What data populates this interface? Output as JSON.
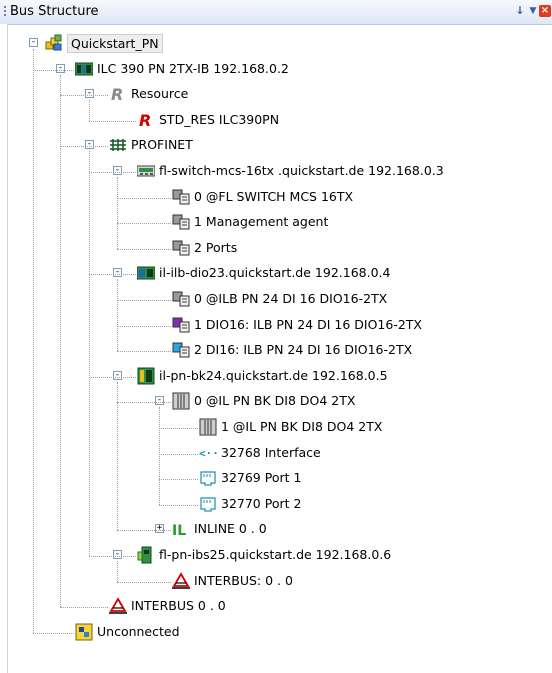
{
  "panel": {
    "title": "Bus Structure",
    "pin_glyph": "↓",
    "menu_glyph": "▼",
    "close_glyph": "×"
  },
  "tree": [
    {
      "label": "Quickstart_PN",
      "icon": "project-icon",
      "level": 0,
      "expander": "minus",
      "selected": true
    },
    {
      "label": "ILC 390 PN 2TX-IB 192.168.0.2",
      "icon": "controller-icon",
      "level": 1,
      "expander": "minus"
    },
    {
      "label": "Resource",
      "icon": "resource-gray-icon",
      "icon_text": "R",
      "level": 2,
      "expander": "minus"
    },
    {
      "label": "STD_RES ILC390PN",
      "icon": "resource-red-icon",
      "icon_text": "R",
      "level": 3,
      "expander": "none"
    },
    {
      "label": "PROFINET",
      "icon": "profinet-icon",
      "level": 2,
      "expander": "minus"
    },
    {
      "label": "fl-switch-mcs-16tx .quickstart.de 192.168.0.3",
      "icon": "switch-icon",
      "level": 3,
      "expander": "minus"
    },
    {
      "label": "0 @FL SWITCH MCS 16TX",
      "icon": "submodule-icon",
      "level": 4,
      "expander": "none"
    },
    {
      "label": "1 Management agent",
      "icon": "submodule-icon",
      "level": 4,
      "expander": "none"
    },
    {
      "label": "2 Ports",
      "icon": "submodule-icon",
      "level": 4,
      "expander": "none"
    },
    {
      "label": "il-ilb-dio23.quickstart.de 192.168.0.4",
      "icon": "ilb-device-icon",
      "level": 3,
      "expander": "minus"
    },
    {
      "label": "0 @ILB PN 24 DI 16 DIO16-2TX",
      "icon": "submodule-icon",
      "level": 4,
      "expander": "none"
    },
    {
      "label": "1 DIO16: ILB PN 24 DI 16 DIO16-2TX",
      "icon": "submodule-purple-icon",
      "level": 4,
      "expander": "none"
    },
    {
      "label": "2 DI16: ILB PN 24 DI 16 DIO16-2TX",
      "icon": "submodule-blue-icon",
      "level": 4,
      "expander": "none"
    },
    {
      "label": "il-pn-bk24.quickstart.de 192.168.0.5",
      "icon": "bus-coupler-icon",
      "level": 3,
      "expander": "minus"
    },
    {
      "label": "0 @IL PN BK DI8 DO4 2TX",
      "icon": "module-icon",
      "level": 4,
      "expander": "minus"
    },
    {
      "label": "1 @IL PN BK DI8 DO4 2TX",
      "icon": "module-icon",
      "level": 5,
      "expander": "none"
    },
    {
      "label": "32768 Interface",
      "icon": "interface-icon",
      "icon_text": "<··>",
      "level": 5,
      "expander": "none"
    },
    {
      "label": "32769 Port 1",
      "icon": "port-icon",
      "level": 5,
      "expander": "none"
    },
    {
      "label": "32770 Port 2",
      "icon": "port-icon",
      "level": 5,
      "expander": "none"
    },
    {
      "label": "INLINE 0 . 0",
      "icon": "inline-icon",
      "icon_text": "IL",
      "level": 4,
      "expander": "plus"
    },
    {
      "label": "fl-pn-ibs25.quickstart.de 192.168.0.6",
      "icon": "ibs-proxy-icon",
      "level": 3,
      "expander": "minus"
    },
    {
      "label": "INTERBUS: 0 . 0",
      "icon": "interbus-icon",
      "level": 4,
      "expander": "none"
    },
    {
      "label": "INTERBUS 0 . 0",
      "icon": "interbus-icon",
      "level": 2,
      "expander": "none"
    },
    {
      "label": "Unconnected",
      "icon": "unconnected-icon",
      "level": 1,
      "expander": "none"
    }
  ],
  "colors": {
    "title_gradient_top": "#f6f8fc",
    "title_gradient_bottom": "#dfe7f5",
    "tree_line": "#a0a0a0",
    "expander_border": "#7f9db9",
    "resource_red": "#d40000",
    "inline_green": "#2a9a2a",
    "interface_teal": "#1a8fb0",
    "interbus_red": "#d40000"
  }
}
